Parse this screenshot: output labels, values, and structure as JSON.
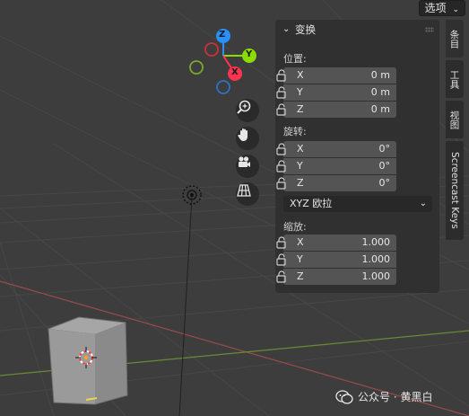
{
  "header": {
    "options_label": "选项"
  },
  "panel": {
    "title": "变换",
    "location": {
      "label": "位置:",
      "rows": [
        {
          "axis": "X",
          "value": "0 m"
        },
        {
          "axis": "Y",
          "value": "0 m"
        },
        {
          "axis": "Z",
          "value": "0 m"
        }
      ]
    },
    "rotation": {
      "label": "旋转:",
      "rows": [
        {
          "axis": "X",
          "value": "0°"
        },
        {
          "axis": "Y",
          "value": "0°"
        },
        {
          "axis": "Z",
          "value": "0°"
        }
      ],
      "mode": "XYZ 欧拉"
    },
    "scale": {
      "label": "缩放:",
      "rows": [
        {
          "axis": "X",
          "value": "1.000"
        },
        {
          "axis": "Y",
          "value": "1.000"
        },
        {
          "axis": "Z",
          "value": "1.000"
        }
      ]
    }
  },
  "tabs": [
    "条目",
    "工具",
    "视图",
    "Screencast Keys"
  ],
  "gizmo": {
    "z": "Z",
    "y": "Y",
    "x": "X"
  },
  "watermark": "公众号 · 黄黑白",
  "colors": {
    "background": "#3d3d3d",
    "x_axis": "#ff3352",
    "y_axis": "#8bdc00",
    "z_axis": "#2890ff"
  }
}
